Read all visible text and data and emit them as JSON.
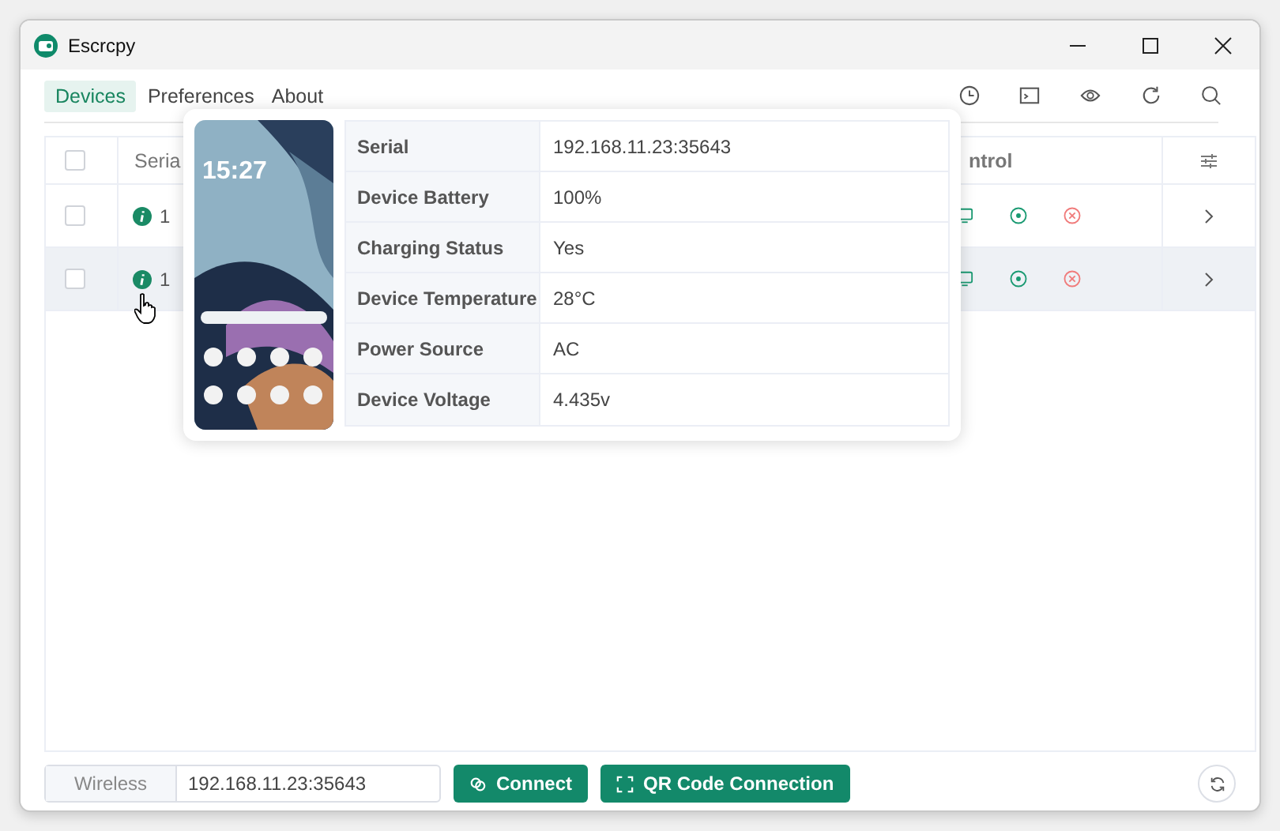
{
  "window": {
    "title": "Escrcpy"
  },
  "tabs": [
    {
      "label": "Devices",
      "selected": true
    },
    {
      "label": "Preferences",
      "selected": false
    },
    {
      "label": "About",
      "selected": false
    }
  ],
  "table": {
    "all_checked": false,
    "columns": [
      "Seria",
      "ntrol"
    ],
    "rows": [
      {
        "checked": false,
        "serial": "1",
        "highlighted": false
      },
      {
        "checked": false,
        "serial": "1",
        "highlighted": true
      }
    ]
  },
  "popup": {
    "clock": "15:27",
    "rows": [
      {
        "label": "Serial",
        "value": "192.168.11.23:35643"
      },
      {
        "label": "Device Battery",
        "value": "100%"
      },
      {
        "label": "Charging Status",
        "value": "Yes"
      },
      {
        "label": "Device Temperature",
        "value": "28°C"
      },
      {
        "label": "Power Source",
        "value": "AC"
      },
      {
        "label": "Device Voltage",
        "value": "4.435v"
      }
    ]
  },
  "connection": {
    "mode": "Wireless",
    "address": "192.168.11.23:35643",
    "buttons": [
      {
        "label": "Connect",
        "kind": "connect"
      },
      {
        "label": "QR Code Connection",
        "kind": "qr"
      }
    ]
  }
}
